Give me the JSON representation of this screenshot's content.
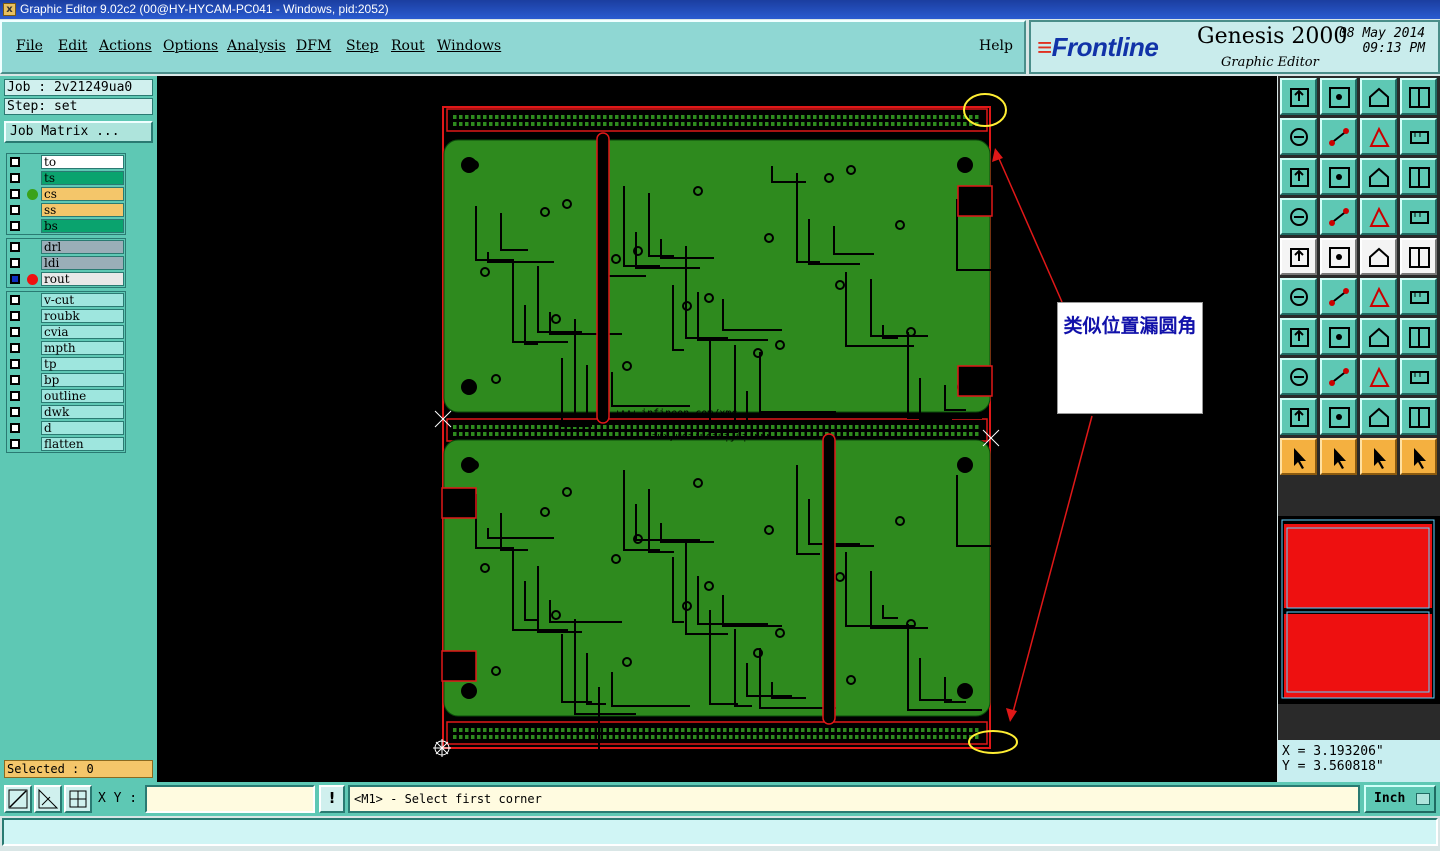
{
  "window": {
    "title": "Graphic Editor 9.02c2 (00@HY-HYCAM-PC041 - Windows, pid:2052)"
  },
  "menu": [
    {
      "label": "File"
    },
    {
      "label": "Edit"
    },
    {
      "label": "Actions"
    },
    {
      "label": "Options"
    },
    {
      "label": "Analysis"
    },
    {
      "label": "DFM"
    },
    {
      "label": "Step"
    },
    {
      "label": "Rout"
    },
    {
      "label": "Windows"
    },
    {
      "label": "Help"
    }
  ],
  "brand": {
    "logo": "Frontline",
    "product": "Genesis 2000",
    "subtitle": "Graphic Editor",
    "date": "08 May 2014",
    "time": "09:13 PM"
  },
  "job": {
    "job_line": "Job : 2v21249ua0",
    "step_line": "Step: set",
    "matrix_button": "Job Matrix ..."
  },
  "layers": {
    "group1": [
      {
        "name": "to",
        "bg": "#ffffff",
        "dot": ""
      },
      {
        "name": "ts",
        "bg": "#0aa36e",
        "dot": ""
      },
      {
        "name": "cs",
        "bg": "#f4c66a",
        "dot": "#3aa21a"
      },
      {
        "name": "ss",
        "bg": "#f4c66a",
        "dot": ""
      },
      {
        "name": "bs",
        "bg": "#0aa36e",
        "dot": ""
      }
    ],
    "group2": [
      {
        "name": "drl",
        "bg": "#9aaeb8",
        "dot": ""
      },
      {
        "name": "ldi",
        "bg": "#9aaeb8",
        "dot": ""
      },
      {
        "name": "rout",
        "bg": "#e8e8e8",
        "dot": "#ee1010"
      }
    ],
    "group3": [
      {
        "name": "v-cut",
        "bg": "#9ee6de",
        "dot": ""
      },
      {
        "name": "roubk",
        "bg": "#9ee6de",
        "dot": ""
      },
      {
        "name": "cvia",
        "bg": "#9ee6de",
        "dot": ""
      },
      {
        "name": "mpth",
        "bg": "#9ee6de",
        "dot": ""
      },
      {
        "name": "tp",
        "bg": "#9ee6de",
        "dot": ""
      },
      {
        "name": "bp",
        "bg": "#9ee6de",
        "dot": ""
      },
      {
        "name": "outline",
        "bg": "#9ee6de",
        "dot": ""
      },
      {
        "name": "dwk",
        "bg": "#9ee6de",
        "dot": ""
      },
      {
        "name": "d",
        "bg": "#9ee6de",
        "dot": ""
      },
      {
        "name": "flatten",
        "bg": "#9ee6de",
        "dot": ""
      }
    ]
  },
  "selected": "Selected : 0",
  "annotation": {
    "text": "类似位置漏圆角"
  },
  "board_silk": {
    "top_url": "www.infineon.com/xmc",
    "bottom_url": "www.infineon.com/xmc"
  },
  "coords": {
    "x": "X = 3.193206\"",
    "y": "Y = 3.560818\""
  },
  "bottom": {
    "xy_label": "X Y :",
    "xy_value": "",
    "excl": "!",
    "prompt": "<M1> - Select first corner",
    "units": "Inch"
  },
  "colors": {
    "board_green": "#2e8a1e",
    "outline_red": "#e01818",
    "highlight_yellow": "#ffee33",
    "panel_teal": "#5ec8b4"
  }
}
